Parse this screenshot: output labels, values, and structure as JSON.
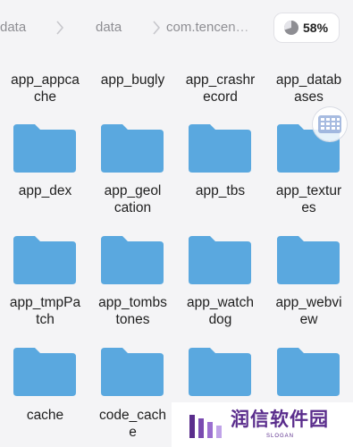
{
  "breadcrumb": {
    "items": [
      "data",
      "data",
      "com.tencen…"
    ]
  },
  "storage": {
    "icon": "pie-chart-icon",
    "percent": "58%"
  },
  "folders": [
    {
      "label": "app_appca\nche"
    },
    {
      "label": "app_bugly"
    },
    {
      "label": "app_crashr\necord"
    },
    {
      "label": "app_datab\nases"
    },
    {
      "label": "app_dex"
    },
    {
      "label": "app_geol\ncation"
    },
    {
      "label": "app_tbs"
    },
    {
      "label": "app_textur\nes"
    },
    {
      "label": "app_tmpPa\ntch"
    },
    {
      "label": "app_tombs\ntones"
    },
    {
      "label": "app_watch\ndog"
    },
    {
      "label": "app_webvi\new"
    },
    {
      "label": "cache"
    },
    {
      "label": "code_cach\ne"
    }
  ],
  "colors": {
    "folder": "#5aa8df",
    "folder_tab": "#5aa8df",
    "accent": "#5a2d8c"
  },
  "watermark": {
    "title": "润信软件园",
    "subtitle": "SLOGAN"
  }
}
